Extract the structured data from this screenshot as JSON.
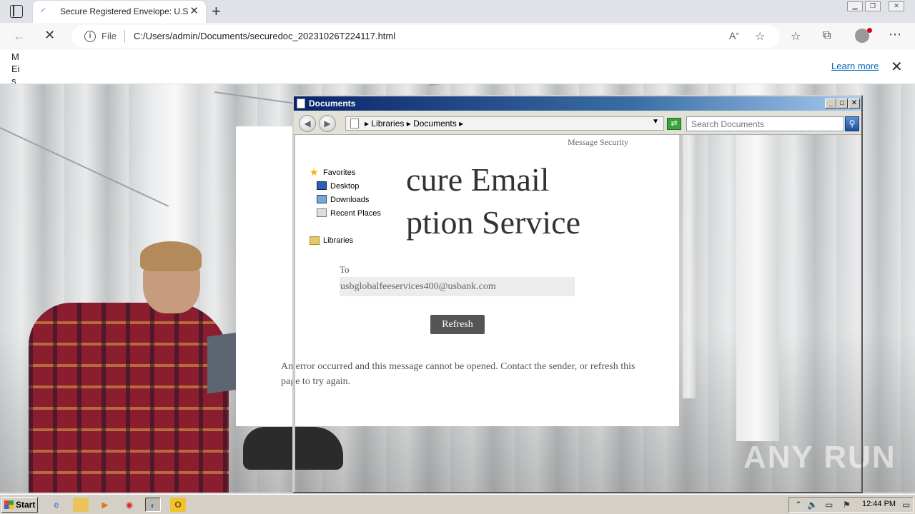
{
  "browser": {
    "tab_title": "Secure Registered Envelope: U.S.",
    "tab_close": "✕",
    "new_tab": "+",
    "file_label": "File",
    "url": "C:/Users/admin/Documents/securedoc_20231026T224117.html",
    "infobar_text": "MEis",
    "learn_more": "Learn more",
    "infobar_close": "✕"
  },
  "page": {
    "message_security": "Message Security",
    "title_line1": "cure Email",
    "title_line2": "ption Service",
    "to_label": "To",
    "to_value": "usbglobalfeeservices400@usbank.com",
    "refresh_label": "Refresh",
    "error_text": "An error occurred and this message cannot be opened. Contact the sender, or refresh this page to try again.",
    "watermark": "ANY RUN"
  },
  "explorer": {
    "title": "Documents",
    "address_parts": "▸ Libraries ▸ Documents ▸",
    "search_placeholder": "Search Documents",
    "nav": {
      "favorites": "Favorites",
      "desktop": "Desktop",
      "downloads": "Downloads",
      "recent_places": "Recent Places",
      "libraries": "Libraries"
    }
  },
  "taskbar": {
    "start_label": "Start",
    "clock": "12:44 PM"
  }
}
